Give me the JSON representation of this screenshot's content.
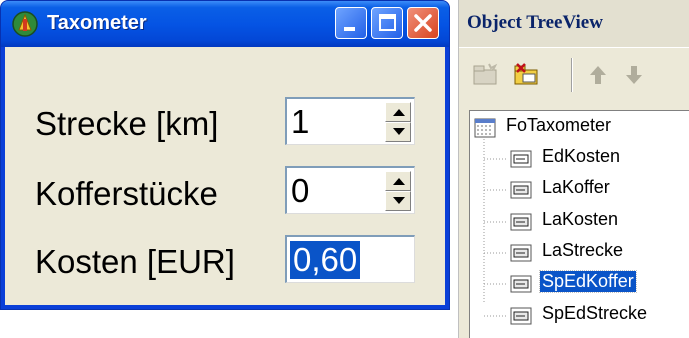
{
  "taxometer": {
    "title": "Taxometer",
    "fields": [
      {
        "label": "Strecke [km]",
        "value": "1"
      },
      {
        "label": "Kofferstücke",
        "value": "0"
      }
    ],
    "result": {
      "label": "Kosten [EUR]",
      "value": "0,60"
    }
  },
  "treeview": {
    "title": "Object TreeView",
    "root": "FoTaxometer",
    "items": [
      "EdKosten",
      "LaKoffer",
      "LaKosten",
      "LaStrecke",
      "SpEdKoffer",
      "SpEdStrecke"
    ],
    "selected": "SpEdKoffer"
  },
  "colors": {
    "titlebar": "#0554e4",
    "client_bg": "#ece9d8",
    "selection": "#0a54c8",
    "close_button": "#d8431f"
  }
}
